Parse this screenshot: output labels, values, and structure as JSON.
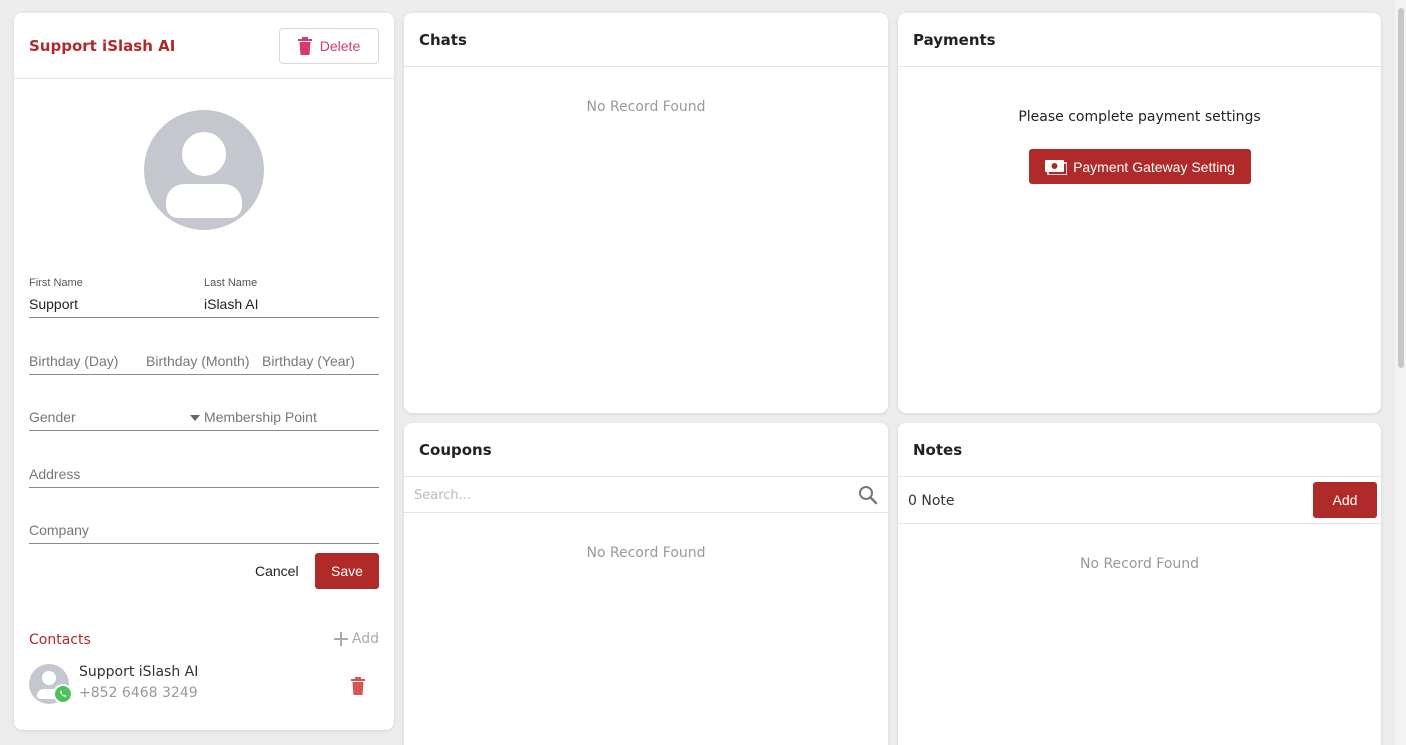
{
  "profile": {
    "title": "Support iSlash AI",
    "delete_label": "Delete",
    "first_name_label": "First Name",
    "first_name_value": "Support",
    "last_name_label": "Last Name",
    "last_name_value": "iSlash AI",
    "birthday_day_placeholder": "Birthday (Day)",
    "birthday_month_placeholder": "Birthday (Month)",
    "birthday_year_placeholder": "Birthday (Year)",
    "gender_placeholder": "Gender",
    "membership_placeholder": "Membership Point",
    "address_placeholder": "Address",
    "company_placeholder": "Company",
    "cancel_label": "Cancel",
    "save_label": "Save"
  },
  "contacts": {
    "title": "Contacts",
    "add_label": "Add",
    "items": [
      {
        "name": "Support iSlash AI",
        "phone": "+852 6468 3249",
        "channel": "whatsapp-icon"
      }
    ]
  },
  "chats": {
    "title": "Chats",
    "empty_text": "No Record Found"
  },
  "payments": {
    "title": "Payments",
    "message": "Please complete payment settings",
    "button_label": "Payment Gateway Setting"
  },
  "coupons": {
    "title": "Coupons",
    "search_placeholder": "Search...",
    "empty_text": "No Record Found"
  },
  "notes": {
    "title": "Notes",
    "count_text": "0 Note",
    "add_label": "Add",
    "empty_text": "No Record Found"
  },
  "colors": {
    "accent": "#b02a2a",
    "delete_pink": "#d63a6b",
    "whatsapp_green": "#4cc35a",
    "avatar_gray": "#c4c7ce"
  }
}
